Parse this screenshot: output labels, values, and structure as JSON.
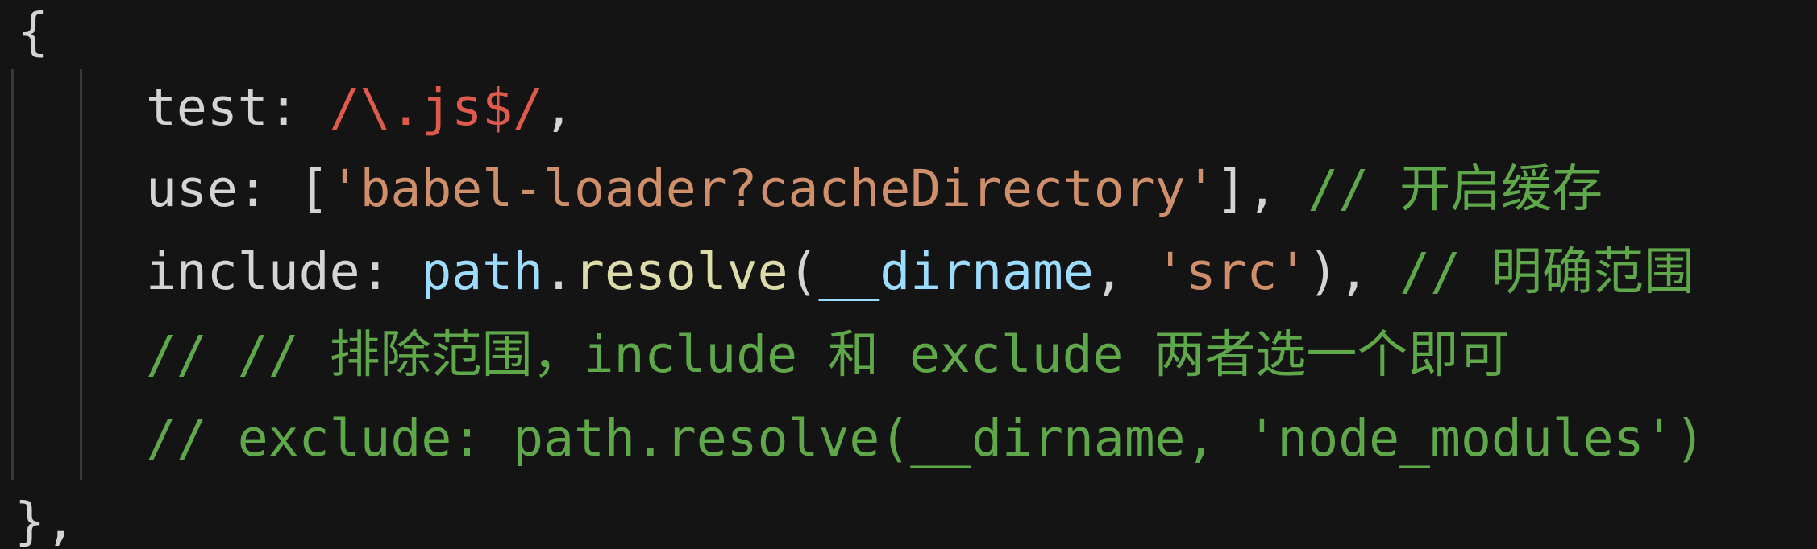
{
  "editor": {
    "lines": [
      {
        "id": "line-1",
        "tokens": [
          {
            "name": "open-brace",
            "type": "plain",
            "text": "{"
          }
        ]
      },
      {
        "id": "line-2",
        "tokens": [
          {
            "name": "key-test",
            "type": "plain",
            "text": "test: "
          },
          {
            "name": "regex-js",
            "type": "regex",
            "text": "/\\.js$/"
          },
          {
            "name": "comma",
            "type": "plain",
            "text": ","
          }
        ]
      },
      {
        "id": "line-3",
        "tokens": [
          {
            "name": "key-use",
            "type": "plain",
            "text": "use: ["
          },
          {
            "name": "string-babel-loader",
            "type": "string",
            "text": "'babel-loader?cacheDirectory'"
          },
          {
            "name": "close-bracket",
            "type": "plain",
            "text": "], "
          },
          {
            "name": "comment-cache",
            "type": "comment",
            "text": "// 开启缓存"
          }
        ]
      },
      {
        "id": "line-4",
        "tokens": [
          {
            "name": "key-include",
            "type": "plain",
            "text": "include: "
          },
          {
            "name": "var-path",
            "type": "var",
            "text": "path"
          },
          {
            "name": "dot",
            "type": "plain",
            "text": "."
          },
          {
            "name": "func-resolve",
            "type": "func",
            "text": "resolve"
          },
          {
            "name": "paren-open",
            "type": "plain",
            "text": "("
          },
          {
            "name": "var-dirname",
            "type": "var",
            "text": "__dirname"
          },
          {
            "name": "comma-space",
            "type": "plain",
            "text": ", "
          },
          {
            "name": "string-src",
            "type": "string",
            "text": "'src'"
          },
          {
            "name": "paren-close",
            "type": "plain",
            "text": "), "
          },
          {
            "name": "comment-range",
            "type": "comment",
            "text": "// 明确范围"
          }
        ]
      },
      {
        "id": "line-5",
        "tokens": [
          {
            "name": "comment-exclude-note",
            "type": "comment",
            "text": "// // 排除范围，include 和 exclude 两者选一个即可"
          }
        ]
      },
      {
        "id": "line-6",
        "tokens": [
          {
            "name": "comment-exclude-line",
            "type": "comment",
            "text": "// exclude: path.resolve(__dirname, 'node_modules')"
          }
        ]
      },
      {
        "id": "line-7",
        "tokens": [
          {
            "name": "close-brace",
            "type": "plain",
            "text": "},"
          }
        ]
      }
    ]
  }
}
